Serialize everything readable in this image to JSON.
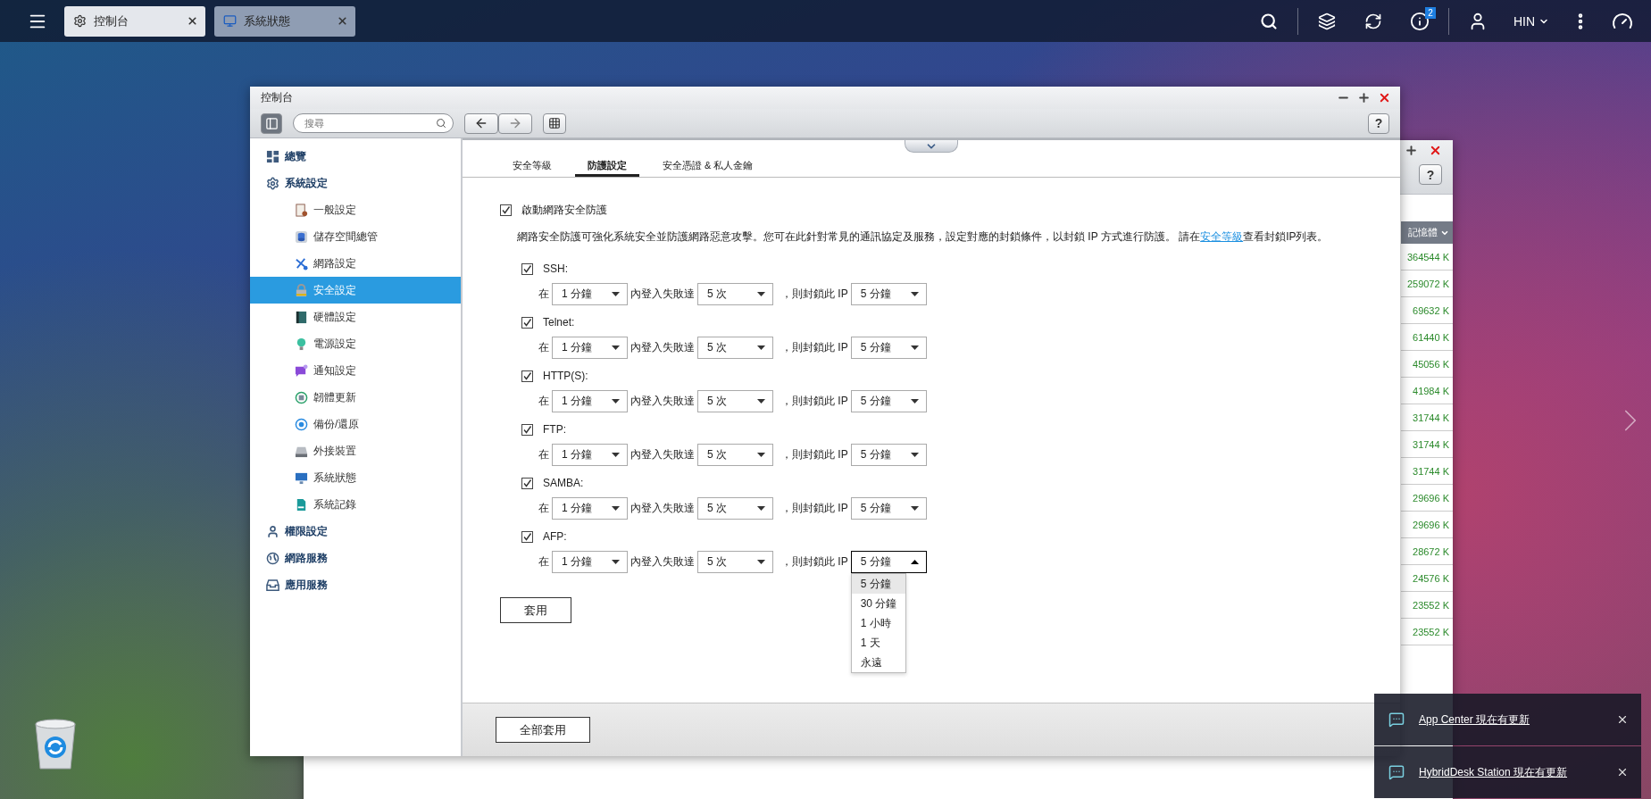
{
  "taskbar": {
    "tabs": [
      {
        "label": "控制台",
        "kind": "gear",
        "selected": true
      },
      {
        "label": "系統狀態",
        "kind": "monitor",
        "selected": false
      }
    ],
    "notification_count": "2",
    "user": "HIN"
  },
  "window": {
    "title": "控制台",
    "search": {
      "placeholder": "搜尋"
    },
    "help": "?",
    "sidebar": [
      {
        "label": "總覽",
        "kind": "overview",
        "selected": false
      },
      {
        "label": "系統設定",
        "kind": "gear",
        "selected": false,
        "children": [
          {
            "label": "一般設定",
            "kind": "general",
            "selected": false
          },
          {
            "label": "儲存空間總管",
            "kind": "storage",
            "selected": false
          },
          {
            "label": "網路設定",
            "kind": "network",
            "selected": false
          },
          {
            "label": "安全設定",
            "kind": "security",
            "selected": true
          },
          {
            "label": "硬體設定",
            "kind": "hardware",
            "selected": false
          },
          {
            "label": "電源設定",
            "kind": "power",
            "selected": false
          },
          {
            "label": "通知設定",
            "kind": "notification",
            "selected": false
          },
          {
            "label": "韌體更新",
            "kind": "firmware",
            "selected": false
          },
          {
            "label": "備份/還原",
            "kind": "backup",
            "selected": false
          },
          {
            "label": "外接裝置",
            "kind": "external",
            "selected": false
          },
          {
            "label": "系統狀態",
            "kind": "status",
            "selected": false
          },
          {
            "label": "系統記錄",
            "kind": "log",
            "selected": false
          }
        ]
      },
      {
        "label": "權限設定",
        "kind": "privilege",
        "selected": false
      },
      {
        "label": "網路服務",
        "kind": "globe",
        "selected": false
      },
      {
        "label": "應用服務",
        "kind": "tray",
        "selected": false
      }
    ],
    "tabs": [
      {
        "label": "安全等級",
        "selected": false
      },
      {
        "label": "防護設定",
        "selected": true
      },
      {
        "label": "安全憑證 & 私人金鑰",
        "selected": false
      }
    ],
    "protection": {
      "label": "啟動網路安全防護",
      "checked": true,
      "description": "網路安全防護可強化系統安全並防護網路惡意攻擊。您可在此針對常見的通訊協定及服務，設定對應的封鎖條件，以封鎖 IP 方式進行防護。 請在",
      "link": "安全等級",
      "description_end": "查看封鎖IP列表。"
    },
    "services": [
      {
        "name": "SSH:",
        "checked": true,
        "prefix": "在",
        "period": "1 分鐘",
        "middle": "內登入失敗達",
        "attempts": "5 次",
        "suffix": "，則封鎖此 IP",
        "block": "5 分鐘",
        "open": false
      },
      {
        "name": "Telnet:",
        "checked": true,
        "prefix": "在",
        "period": "1 分鐘",
        "middle": "內登入失敗達",
        "attempts": "5 次",
        "suffix": "，則封鎖此 IP",
        "block": "5 分鐘",
        "open": false
      },
      {
        "name": "HTTP(S):",
        "checked": true,
        "prefix": "在",
        "period": "1 分鐘",
        "middle": "內登入失敗達",
        "attempts": "5 次",
        "suffix": "，則封鎖此 IP",
        "block": "5 分鐘",
        "open": false
      },
      {
        "name": "FTP:",
        "checked": true,
        "prefix": "在",
        "period": "1 分鐘",
        "middle": "內登入失敗達",
        "attempts": "5 次",
        "suffix": "，則封鎖此 IP",
        "block": "5 分鐘",
        "open": false
      },
      {
        "name": "SAMBA:",
        "checked": true,
        "prefix": "在",
        "period": "1 分鐘",
        "middle": "內登入失敗達",
        "attempts": "5 次",
        "suffix": "，則封鎖此 IP",
        "block": "5 分鐘",
        "open": false
      },
      {
        "name": "AFP:",
        "checked": true,
        "prefix": "在",
        "period": "1 分鐘",
        "middle": "內登入失敗達",
        "attempts": "5 次",
        "suffix": "，則封鎖此 IP",
        "block": "5 分鐘",
        "open": true,
        "options": [
          {
            "label": "5 分鐘",
            "selected": true
          },
          {
            "label": "30 分鐘",
            "selected": false
          },
          {
            "label": "1 小時",
            "selected": false
          },
          {
            "label": "1 天",
            "selected": false
          },
          {
            "label": "永遠",
            "selected": false
          }
        ]
      }
    ],
    "apply": "套用",
    "apply_all": "全部套用"
  },
  "background_window": {
    "help": "?",
    "column": "記憶體",
    "values": [
      "364544 K",
      "259072 K",
      "69632 K",
      "61440 K",
      "45056 K",
      "41984 K",
      "31744 K",
      "31744 K",
      "31744 K",
      "29696 K",
      "29696 K",
      "28672 K",
      "24576 K",
      "23552 K",
      "23552 K"
    ]
  },
  "notifications": [
    {
      "text": "App Center 現在有更新"
    },
    {
      "text": "HybridDesk Station 現在有更新"
    }
  ]
}
